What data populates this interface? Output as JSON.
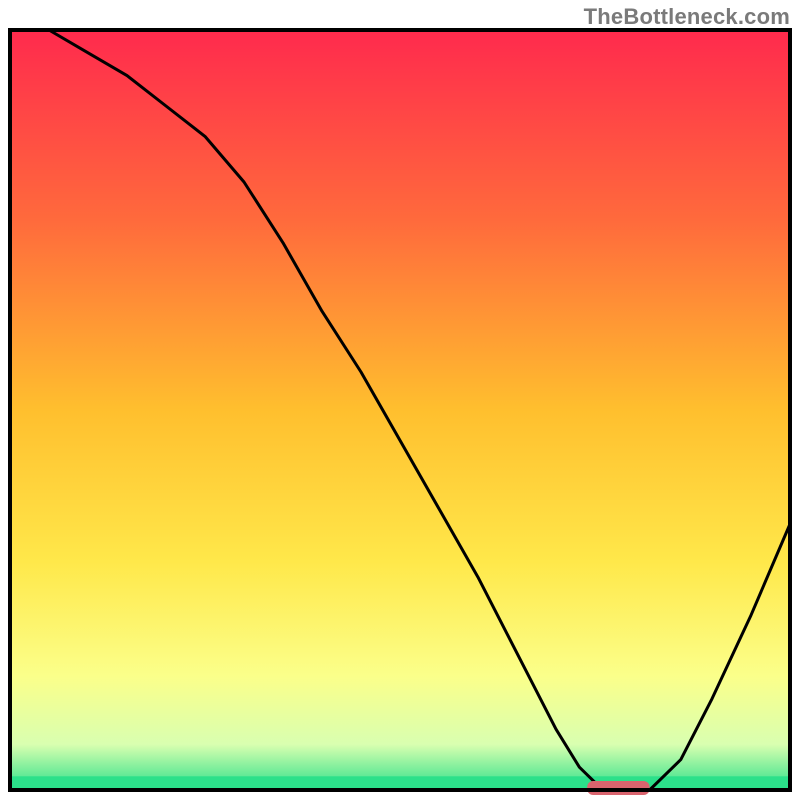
{
  "watermark": "TheBottleneck.com",
  "chart_data": {
    "type": "line",
    "title": "",
    "xlabel": "",
    "ylabel": "",
    "xlim": [
      0,
      100
    ],
    "ylim": [
      0,
      100
    ],
    "grid": false,
    "legend": false,
    "plot_background_gradient": {
      "stops": [
        {
          "offset": 0.0,
          "color": "#ff2a4d"
        },
        {
          "offset": 0.25,
          "color": "#ff6a3c"
        },
        {
          "offset": 0.5,
          "color": "#ffbf2e"
        },
        {
          "offset": 0.7,
          "color": "#ffe84a"
        },
        {
          "offset": 0.85,
          "color": "#fbff8a"
        },
        {
          "offset": 0.94,
          "color": "#d9ffb0"
        },
        {
          "offset": 1.0,
          "color": "#2ce08a"
        }
      ]
    },
    "series": [
      {
        "name": "bottleneck-curve",
        "stroke": "#000000",
        "x": [
          5,
          10,
          15,
          20,
          25,
          30,
          35,
          40,
          45,
          50,
          55,
          60,
          63,
          67,
          70,
          73,
          75,
          78,
          82,
          86,
          90,
          95,
          100
        ],
        "y": [
          100,
          97,
          94,
          90,
          86,
          80,
          72,
          63,
          55,
          46,
          37,
          28,
          22,
          14,
          8,
          3,
          1,
          0,
          0,
          4,
          12,
          23,
          35
        ]
      }
    ],
    "marker": {
      "name": "optimal-range-marker",
      "x_center": 78,
      "y": 0,
      "width_x": 8,
      "color": "#d9646e"
    }
  }
}
